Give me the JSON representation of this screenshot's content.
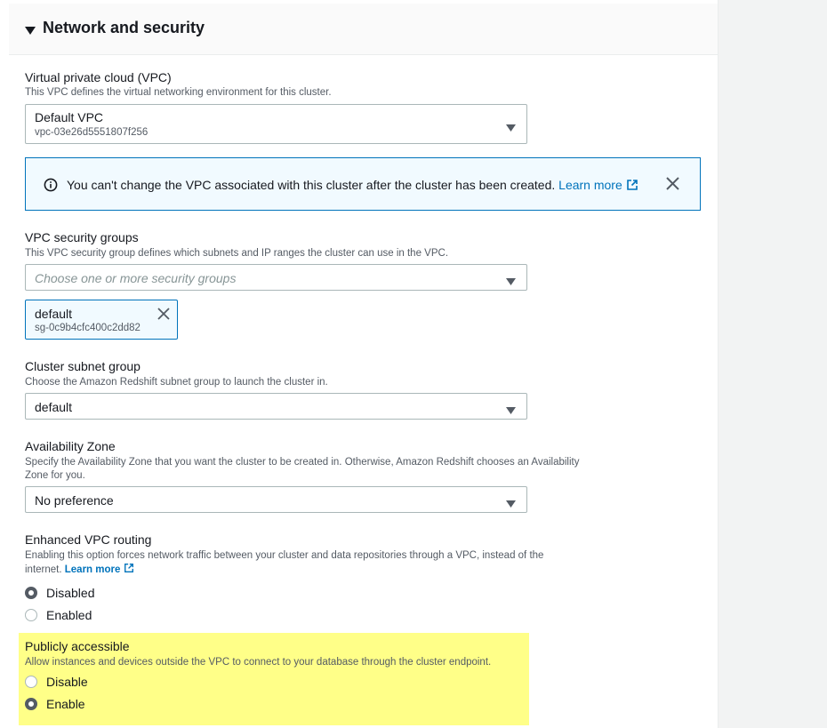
{
  "section": {
    "title": "Network and security"
  },
  "vpc": {
    "label": "Virtual private cloud (VPC)",
    "description": "This VPC defines the virtual networking environment for this cluster.",
    "value": "Default VPC",
    "id": "vpc-03e26d5551807f256"
  },
  "alert": {
    "message": "You can't change the VPC associated with this cluster after the cluster has been created.",
    "link": "Learn more"
  },
  "security_groups": {
    "label": "VPC security groups",
    "description": "This VPC security group defines which subnets and IP ranges the cluster can use in the VPC.",
    "placeholder": "Choose one or more security groups",
    "token": {
      "name": "default",
      "id": "sg-0c9b4cfc400c2dd82"
    }
  },
  "subnet_group": {
    "label": "Cluster subnet group",
    "description": "Choose the Amazon Redshift subnet group to launch the cluster in.",
    "value": "default"
  },
  "availability_zone": {
    "label": "Availability Zone",
    "description_line1": "Specify the Availability Zone that you want the cluster to be created in. Otherwise, Amazon Redshift chooses an Availability",
    "description_line2": "Zone for you.",
    "value": "No preference"
  },
  "enhanced_routing": {
    "label": "Enhanced VPC routing",
    "description_line1": "Enabling this option forces network traffic between your cluster and data repositories through a VPC, instead of the",
    "description_line2": "internet.",
    "link": "Learn more",
    "options": [
      "Disabled",
      "Enabled"
    ],
    "selected": "Disabled"
  },
  "public_access": {
    "label": "Publicly accessible",
    "description": "Allow instances and devices outside the VPC to connect to your database through the cluster endpoint.",
    "options": [
      "Disable",
      "Enable"
    ],
    "selected": "Enable",
    "highlight_color": "#ffff88"
  },
  "colors": {
    "link": "#0073bb",
    "border": "#aab7b8",
    "text": "#16191f",
    "muted": "#545b64"
  }
}
